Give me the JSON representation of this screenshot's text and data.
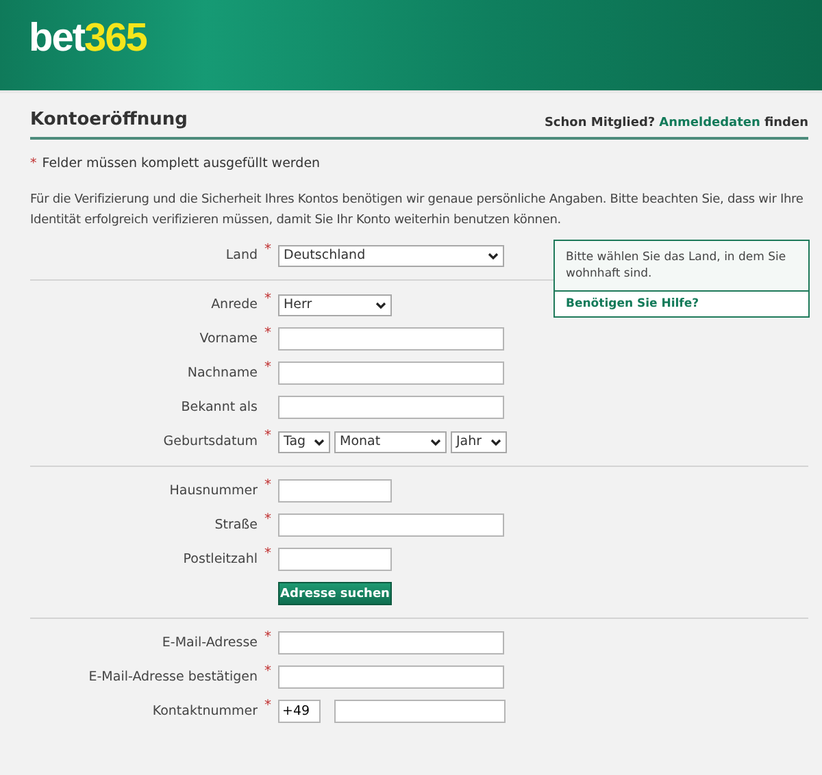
{
  "header": {
    "logo_main": "bet",
    "logo_accent": "365"
  },
  "page": {
    "title": "Kontoeröffnung",
    "member_prompt": "Schon Mitglied?",
    "member_link": "Anmeldedaten",
    "member_suffix": "finden"
  },
  "required_note": {
    "mark": "*",
    "text": "Felder müssen komplett ausgefüllt werden"
  },
  "intro": "Für die Verifizierung und die Sicherheit Ihres Kontos benötigen wir genaue persönliche Angaben. Bitte beachten Sie, dass wir Ihre Identität erfolgreich verifizieren müssen, damit Sie Ihr Konto weiterhin benutzen können.",
  "sections": [
    {
      "rows": [
        {
          "label": "Land",
          "required_mark": "*",
          "kind": "select",
          "value": "Deutschland"
        }
      ],
      "tooltip": {
        "text": "Bitte wählen Sie das Land, in dem Sie wohnhaft sind.",
        "link": "Benötigen Sie Hilfe?"
      }
    },
    {
      "rows": [
        {
          "label": "Anrede",
          "required_mark": "*",
          "kind": "select-short",
          "value": "Herr"
        },
        {
          "label": "Vorname",
          "required_mark": "*",
          "kind": "text"
        },
        {
          "label": "Nachname",
          "required_mark": "*",
          "kind": "text"
        },
        {
          "label": "Bekannt als",
          "kind": "text"
        },
        {
          "label": "Geburtsdatum",
          "required_mark": "*",
          "kind": "date",
          "parts": [
            "Tag",
            "Monat",
            "Jahr"
          ]
        }
      ]
    },
    {
      "rows": [
        {
          "label": "Hausnummer",
          "required_mark": "*",
          "kind": "text-short"
        },
        {
          "label": "Straße",
          "required_mark": "*",
          "kind": "text"
        },
        {
          "label": "Postleitzahl",
          "required_mark": "*",
          "kind": "text-short"
        }
      ],
      "button": "Adresse suchen"
    },
    {
      "rows": [
        {
          "label": "E-Mail-Adresse",
          "required_mark": "*",
          "kind": "text"
        },
        {
          "label": "E-Mail-Adresse bestätigen",
          "required_mark": "*",
          "kind": "text"
        },
        {
          "label": "Kontaktnummer",
          "required_mark": "*",
          "kind": "phone",
          "prefix": "+49"
        }
      ]
    }
  ]
}
